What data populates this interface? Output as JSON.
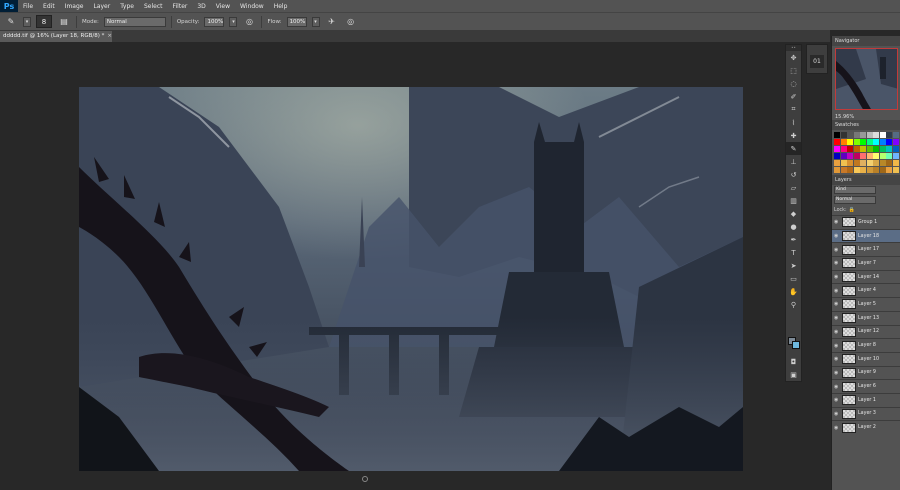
{
  "app": {
    "logo": "Ps"
  },
  "menu": [
    "File",
    "Edit",
    "Image",
    "Layer",
    "Type",
    "Select",
    "Filter",
    "3D",
    "View",
    "Window",
    "Help"
  ],
  "options": {
    "brush_size": "8",
    "mode_label": "Mode:",
    "mode_value": "Normal",
    "opacity_label": "Opacity:",
    "opacity_value": "100%",
    "flow_label": "Flow:",
    "flow_value": "100%"
  },
  "document": {
    "tab_title": "ddddd.tif @ 16% (Layer 18, RGB/8) *",
    "close_glyph": "×"
  },
  "navigator": {
    "tab": "Navigator",
    "zoom": "15.96%"
  },
  "swatches": {
    "tab": "Swatches",
    "colors": [
      "#000000",
      "#333333",
      "#555555",
      "#777777",
      "#999999",
      "#bbbbbb",
      "#dddddd",
      "#ffffff",
      "#2f3b4a",
      "#556b83",
      "#ff0000",
      "#ff8000",
      "#ffff00",
      "#80ff00",
      "#00ff00",
      "#00ff80",
      "#00ffff",
      "#0080ff",
      "#0000ff",
      "#8000ff",
      "#ff00ff",
      "#ff0080",
      "#c00000",
      "#c06000",
      "#c0c000",
      "#60c000",
      "#00c000",
      "#00c060",
      "#00c0c0",
      "#0060c0",
      "#0000c0",
      "#6000c0",
      "#c000c0",
      "#c00060",
      "#ff6f6f",
      "#ffb46f",
      "#ffff6f",
      "#b4ff6f",
      "#6fffb4",
      "#6fb4ff",
      "#e8a040",
      "#f0c050",
      "#d89030",
      "#c07820",
      "#e0b060",
      "#f4d070",
      "#d8a848",
      "#b88828",
      "#a06818",
      "#f0b848",
      "#e09838",
      "#c87828",
      "#b06818",
      "#f8c858",
      "#e8b048",
      "#d09838",
      "#b88028",
      "#a06818",
      "#e8a040",
      "#f0c050"
    ]
  },
  "layers": {
    "tab": "Layers",
    "kind_label": "Kind",
    "blend_mode": "Normal",
    "lock_label": "Lock:",
    "rows": [
      {
        "name": "Group 1",
        "selected": false
      },
      {
        "name": "Layer 18",
        "selected": true
      },
      {
        "name": "Layer 17",
        "selected": false
      },
      {
        "name": "Layer 7",
        "selected": false
      },
      {
        "name": "Layer 14",
        "selected": false
      },
      {
        "name": "Layer 4",
        "selected": false
      },
      {
        "name": "Layer 5",
        "selected": false
      },
      {
        "name": "Layer 13",
        "selected": false
      },
      {
        "name": "Layer 12",
        "selected": false
      },
      {
        "name": "Layer 8",
        "selected": false
      },
      {
        "name": "Layer 10",
        "selected": false
      },
      {
        "name": "Layer 9",
        "selected": false
      },
      {
        "name": "Layer 6",
        "selected": false
      },
      {
        "name": "Layer 1",
        "selected": false
      },
      {
        "name": "Layer 3",
        "selected": false
      },
      {
        "name": "Layer 2",
        "selected": false
      }
    ]
  },
  "tools": [
    "move",
    "marquee",
    "lasso",
    "quick-select",
    "crop",
    "eyedropper",
    "healing",
    "brush",
    "clone-stamp",
    "history-brush",
    "eraser",
    "gradient",
    "blur",
    "dodge",
    "pen",
    "type",
    "path-select",
    "shape",
    "hand",
    "zoom"
  ]
}
